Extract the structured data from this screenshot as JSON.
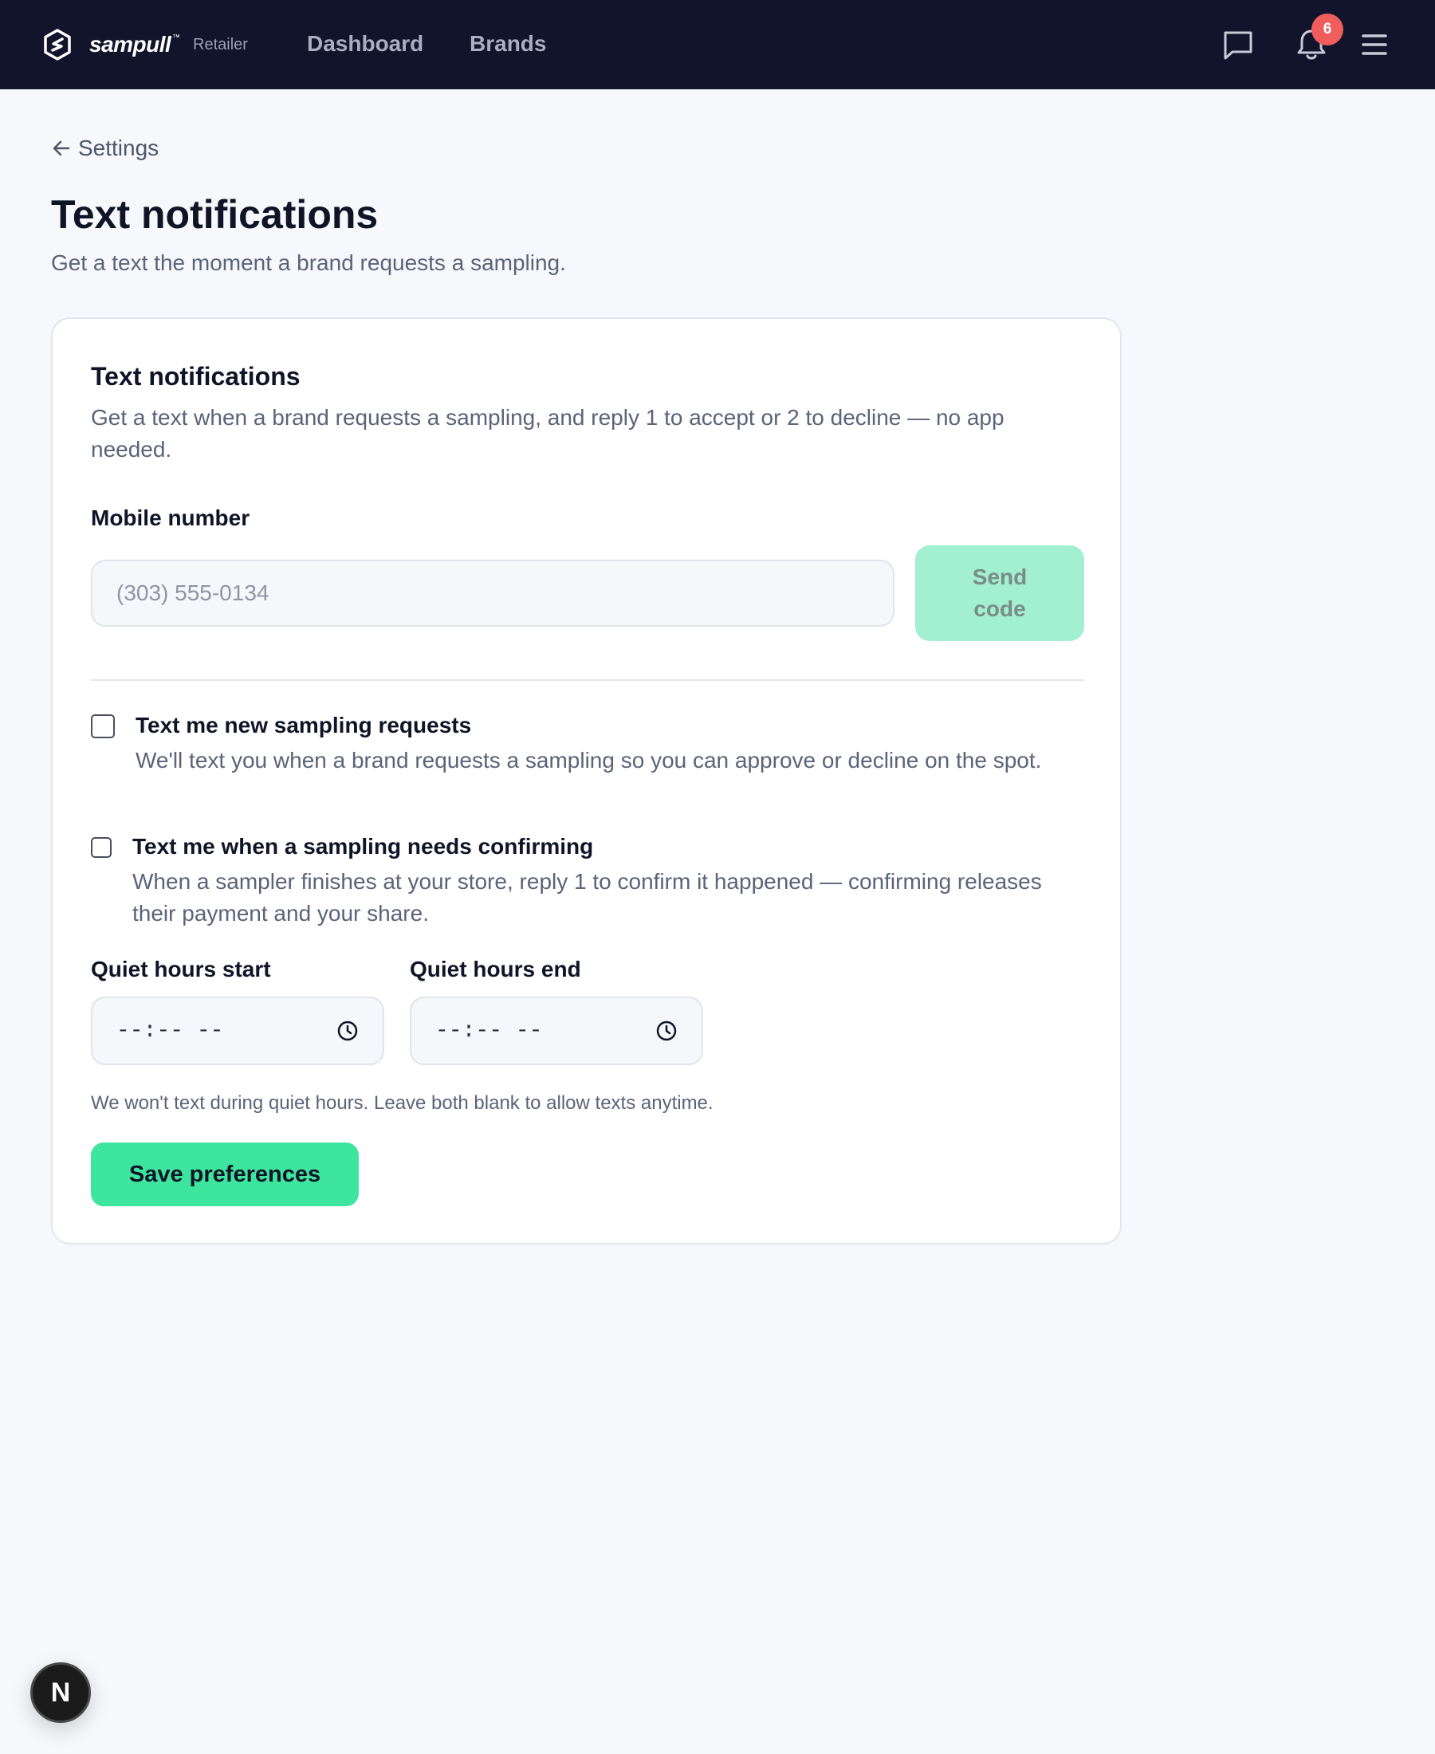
{
  "app": {
    "brand": "sampull",
    "brand_tm": "™",
    "role": "Retailer",
    "nav": {
      "dashboard": "Dashboard",
      "brands": "Brands"
    },
    "notification_count": "6",
    "icons": [
      "logo-icon",
      "chat-icon",
      "bell-icon",
      "menu-icon"
    ],
    "colors": {
      "topbar": "#11142a",
      "accent": "#3ee59f",
      "accent_disabled": "#a2f0d1",
      "badge": "#f05d5d"
    }
  },
  "page": {
    "back_label": "Settings",
    "title": "Text notifications",
    "subtitle": "Get a text the moment a brand requests a sampling."
  },
  "card": {
    "title": "Text notifications",
    "description": "Get a text when a brand requests a sampling, and reply 1 to accept or 2 to decline — no app needed.",
    "mobile_label": "Mobile number",
    "mobile_placeholder": "(303) 555-0134",
    "mobile_value": "",
    "send_code_label": "Send code",
    "options": [
      {
        "title": "Text me new sampling requests",
        "description": "We'll text you when a brand requests a sampling so you can approve or decline on the spot.",
        "checked": false
      },
      {
        "title": "Text me when a sampling needs confirming",
        "description": "When a sampler finishes at your store, reply 1 to confirm it happened — confirming releases their payment and your share.",
        "checked": false
      }
    ],
    "quiet_start_label": "Quiet hours start",
    "quiet_start_value": "--:-- --",
    "quiet_end_label": "Quiet hours end",
    "quiet_end_value": "--:-- --",
    "quiet_hint": "We won't text during quiet hours. Leave both blank to allow texts anytime.",
    "save_label": "Save preferences"
  },
  "dev_badge": "N"
}
